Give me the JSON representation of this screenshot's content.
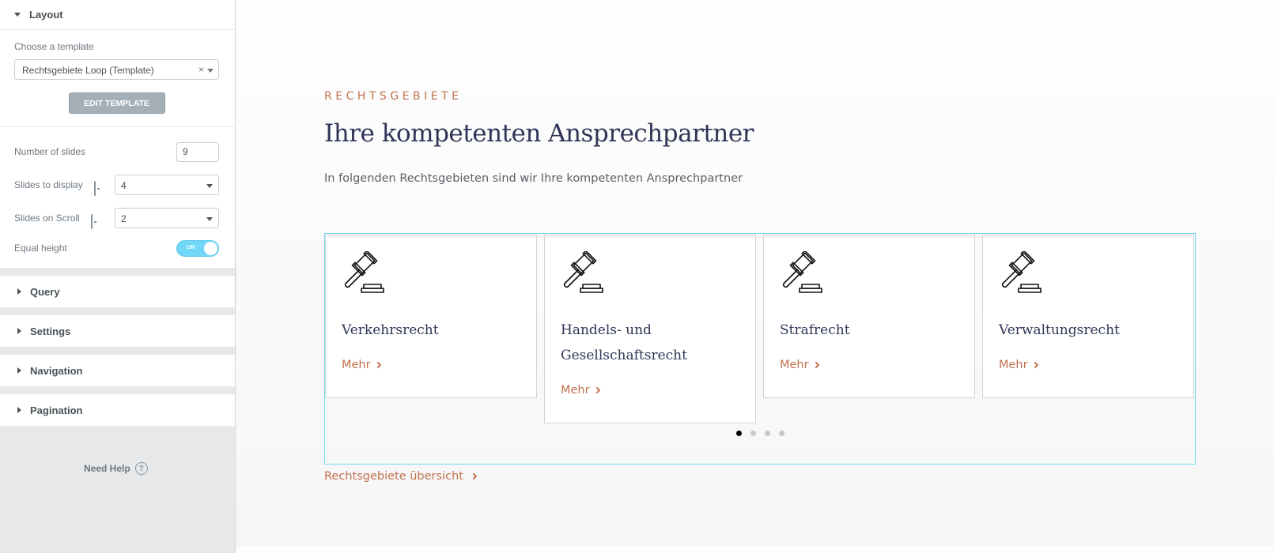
{
  "sidebar": {
    "layout": {
      "title": "Layout",
      "template_label": "Choose a template",
      "template_value": "Rechtsgebiete Loop (Template)",
      "template_clear": "×",
      "edit_button": "Edit Template"
    },
    "controls": {
      "number_of_slides_label": "Number of slides",
      "number_of_slides_value": "9",
      "slides_to_display_label": "Slides to display",
      "slides_to_display_value": "4",
      "slides_on_scroll_label": "Slides on Scroll",
      "slides_on_scroll_value": "2",
      "equal_height_label": "Equal height",
      "equal_height_toggle": "ON"
    },
    "sections": [
      "Query",
      "Settings",
      "Navigation",
      "Pagination"
    ],
    "help": {
      "label": "Need Help",
      "icon": "?"
    }
  },
  "main": {
    "kicker": "RECHTSGEBIETE",
    "heading": "Ihre kompetenten Ansprechpartner",
    "subheading": "In folgenden Rechtsgebieten sind wir Ihre kompetenten Ansprechpartner",
    "cards": [
      {
        "title": "Verkehrsrecht",
        "link": "Mehr"
      },
      {
        "title": "Handels- und Gesellschaftsrecht",
        "link": "Mehr"
      },
      {
        "title": "Strafrecht",
        "link": "Mehr"
      },
      {
        "title": "Verwaltungsrecht",
        "link": "Mehr"
      }
    ],
    "pagination": {
      "count": 4,
      "active": 1
    },
    "overview_link": "Rechtsgebiete übersicht"
  },
  "colors": {
    "accent": "#c2714f",
    "heading": "#2f3556",
    "carousel_outline": "#71d7f7",
    "toggle": "#71d7f7"
  }
}
